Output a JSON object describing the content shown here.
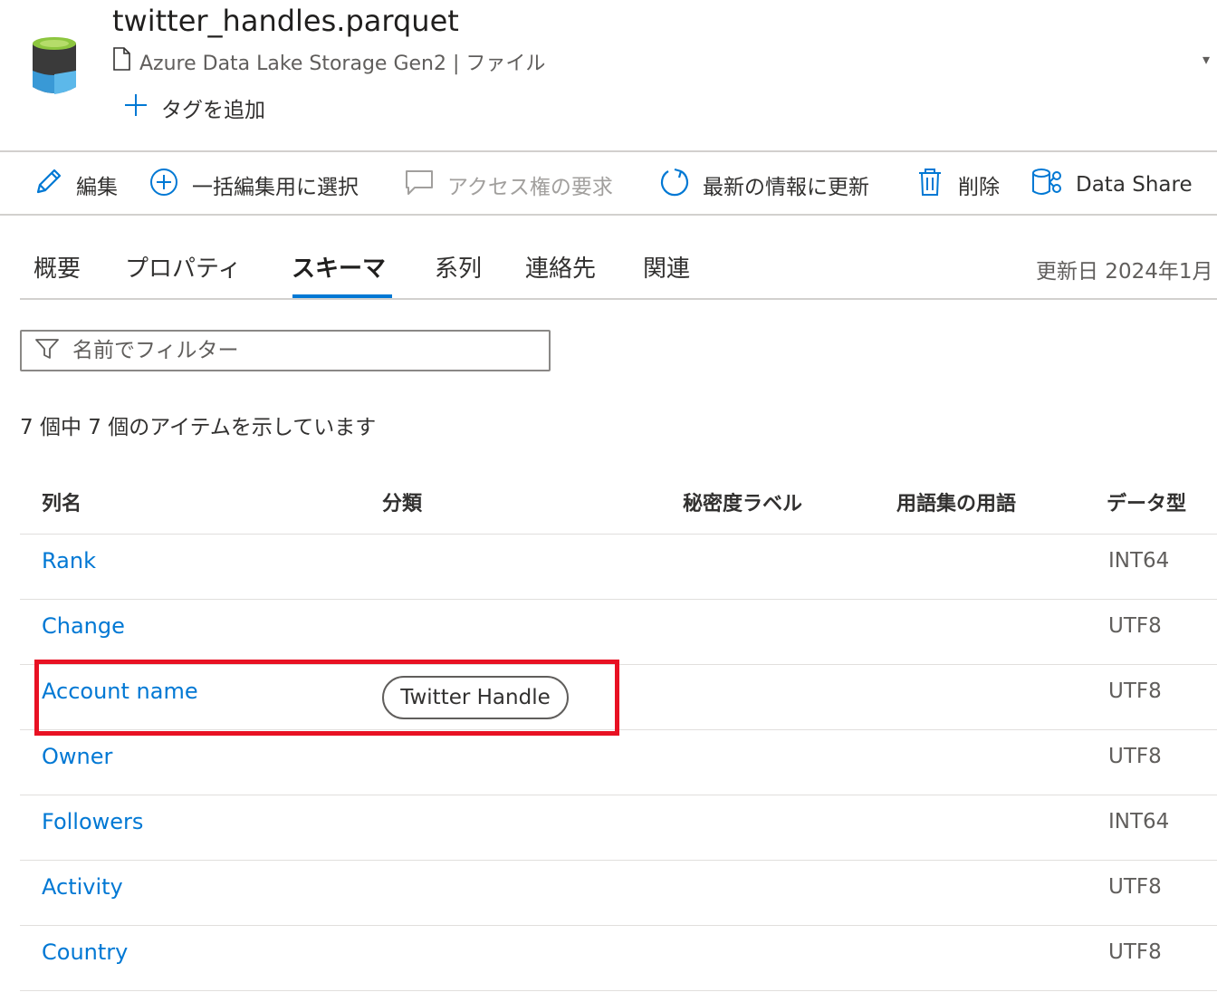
{
  "header": {
    "title": "twitter_handles.parquet",
    "subtitle": "Azure Data Lake Storage Gen2 | ファイル",
    "add_tag": "タグを追加"
  },
  "toolbar": {
    "edit": "編集",
    "bulk_select": "一括編集用に選択",
    "request_access": "アクセス権の要求",
    "refresh": "最新の情報に更新",
    "delete": "削除",
    "data_share": "Data Share"
  },
  "tabs": {
    "items": [
      "概要",
      "プロパティ",
      "スキーマ",
      "系列",
      "連絡先",
      "関連"
    ],
    "active": "スキーマ",
    "updated": "更新日 2024年1月"
  },
  "filter": {
    "placeholder": "名前でフィルター"
  },
  "count_text": "7 個中 7 個のアイテムを示しています",
  "table": {
    "headers": [
      "列名",
      "分類",
      "秘密度ラベル",
      "用語集の用語",
      "データ型"
    ],
    "rows": [
      {
        "name": "Rank",
        "classification": "",
        "type": "INT64"
      },
      {
        "name": "Change",
        "classification": "",
        "type": "UTF8"
      },
      {
        "name": "Account name",
        "classification": "Twitter Handle",
        "type": "UTF8"
      },
      {
        "name": "Owner",
        "classification": "",
        "type": "UTF8"
      },
      {
        "name": "Followers",
        "classification": "",
        "type": "INT64"
      },
      {
        "name": "Activity",
        "classification": "",
        "type": "UTF8"
      },
      {
        "name": "Country",
        "classification": "",
        "type": "UTF8"
      }
    ]
  },
  "colors": {
    "accent": "#0078d4",
    "highlight": "#e81123",
    "text": "#323130"
  }
}
